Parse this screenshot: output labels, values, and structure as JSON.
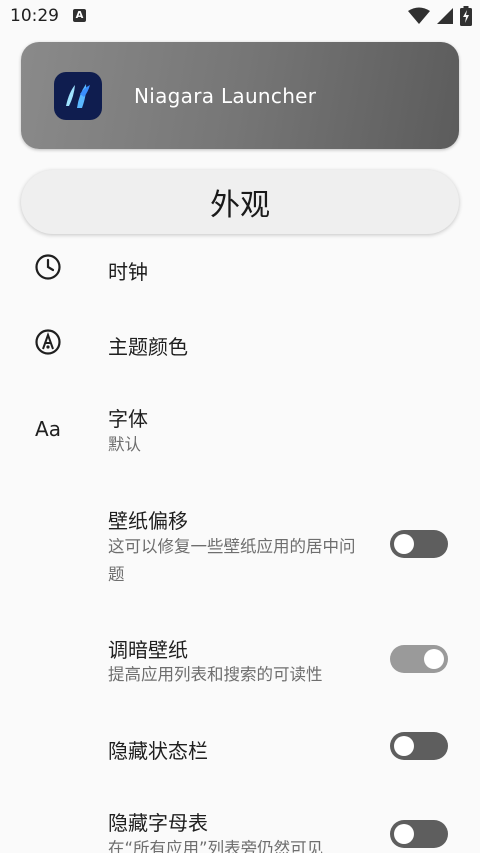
{
  "status_bar": {
    "time": "10:29",
    "notification_letter": "A"
  },
  "header": {
    "app_name": "Niagara Launcher"
  },
  "section": {
    "title": "外观"
  },
  "settings": {
    "clock": {
      "title": "时钟"
    },
    "theme_color": {
      "title": "主题颜色"
    },
    "font": {
      "title": "字体",
      "value": "默认",
      "icon_text": "Aa"
    },
    "wallpaper_offset": {
      "title": "壁纸偏移",
      "subtitle": "这可以修复一些壁纸应用的居中问题",
      "enabled": false
    },
    "dim_wallpaper": {
      "title": "调暗壁纸",
      "subtitle": "提高应用列表和搜索的可读性",
      "enabled": true
    },
    "hide_status_bar": {
      "title": "隐藏状态栏",
      "enabled": false
    },
    "hide_alphabet": {
      "title": "隐藏字母表",
      "subtitle": "在“所有应用”列表旁仍然可见",
      "enabled": false
    }
  }
}
